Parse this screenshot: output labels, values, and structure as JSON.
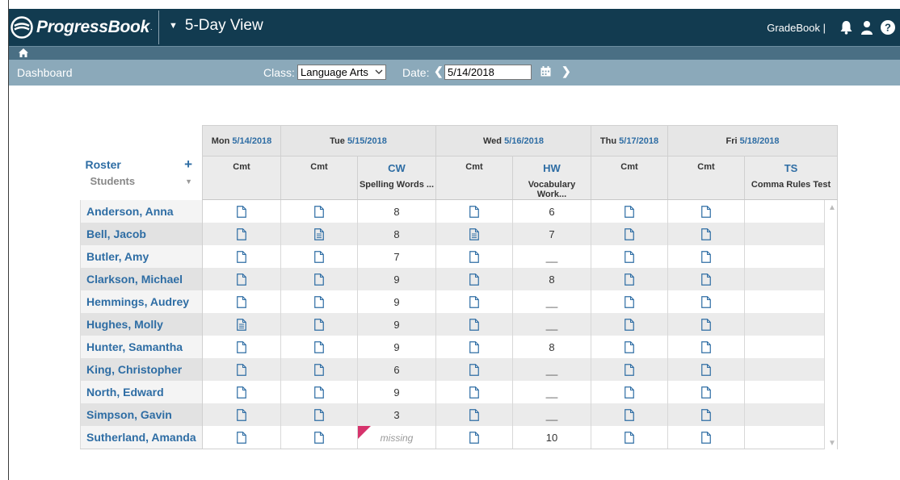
{
  "app": {
    "brand": "ProgressBook",
    "view_title": "5-Day View",
    "gradebook_label": "GradeBook |"
  },
  "nav": {
    "dashboard": "Dashboard",
    "class_label": "Class:",
    "class_value": "Language Arts",
    "date_label": "Date:",
    "date_value": "5/14/2018"
  },
  "roster": {
    "title": "Roster",
    "add": "+",
    "students_label": "Students"
  },
  "days": [
    {
      "day": "Mon",
      "date": "5/14/2018"
    },
    {
      "day": "Tue",
      "date": "5/15/2018"
    },
    {
      "day": "Wed",
      "date": "5/16/2018"
    },
    {
      "day": "Thu",
      "date": "5/17/2018"
    },
    {
      "day": "Fri",
      "date": "5/18/2018"
    }
  ],
  "columns": [
    {
      "code": "Cmt",
      "name": ""
    },
    {
      "code": "Cmt",
      "name": ""
    },
    {
      "code": "CW",
      "name": "Spelling Words ..."
    },
    {
      "code": "Cmt",
      "name": ""
    },
    {
      "code": "HW",
      "name": "Vocabulary Work..."
    },
    {
      "code": "Cmt",
      "name": ""
    },
    {
      "code": "Cmt",
      "name": ""
    },
    {
      "code": "TS",
      "name": "Comma Rules Test"
    }
  ],
  "missing_label": "missing",
  "dash_label": "__",
  "students": [
    {
      "name": "Anderson, Anna",
      "cw": "8",
      "hw": "6",
      "notes": [
        0,
        0,
        0,
        0,
        0
      ]
    },
    {
      "name": "Bell, Jacob",
      "cw": "8",
      "hw": "7",
      "notes": [
        0,
        1,
        1,
        0,
        0
      ]
    },
    {
      "name": "Butler, Amy",
      "cw": "7",
      "hw": "__",
      "notes": [
        0,
        0,
        0,
        0,
        0
      ]
    },
    {
      "name": "Clarkson, Michael",
      "cw": "9",
      "hw": "8",
      "notes": [
        0,
        0,
        0,
        0,
        0
      ]
    },
    {
      "name": "Hemmings, Audrey",
      "cw": "9",
      "hw": "__",
      "notes": [
        0,
        0,
        0,
        0,
        0
      ]
    },
    {
      "name": "Hughes, Molly",
      "cw": "9",
      "hw": "__",
      "notes": [
        1,
        0,
        0,
        0,
        0
      ]
    },
    {
      "name": "Hunter, Samantha",
      "cw": "9",
      "hw": "8",
      "notes": [
        0,
        0,
        0,
        0,
        0
      ]
    },
    {
      "name": "King, Christopher",
      "cw": "6",
      "hw": "__",
      "notes": [
        0,
        0,
        0,
        0,
        0
      ]
    },
    {
      "name": "North, Edward",
      "cw": "9",
      "hw": "__",
      "notes": [
        0,
        0,
        0,
        0,
        0
      ]
    },
    {
      "name": "Simpson, Gavin",
      "cw": "3",
      "hw": "__",
      "notes": [
        0,
        0,
        0,
        0,
        0
      ]
    },
    {
      "name": "Sutherland, Amanda",
      "cw": "missing",
      "hw": "10",
      "notes": [
        0,
        0,
        0,
        0,
        0
      ]
    }
  ],
  "colors": {
    "topbar": "#123b50",
    "navbar": "#8ba9ba",
    "link": "#2e6da4",
    "missing_flag": "#d6336c"
  }
}
